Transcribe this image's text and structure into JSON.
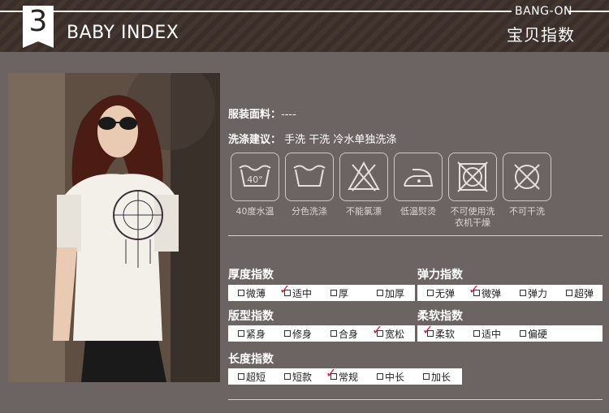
{
  "header": {
    "number": "3",
    "title_en": "BABY INDEX",
    "brand": "BANG-ON",
    "title_cn": "宝贝指数"
  },
  "material": {
    "label": "服装面料：",
    "value": "----"
  },
  "wash": {
    "label": "洗涤建议：",
    "value": "手洗 干洗 冷水单独洗涤"
  },
  "care_icons": [
    {
      "icon": "wash-40-icon",
      "caption": "40度水温"
    },
    {
      "icon": "wash-basin-icon",
      "caption": "分色洗涤"
    },
    {
      "icon": "no-bleach-icon",
      "caption": "不能氯漂"
    },
    {
      "icon": "low-iron-icon",
      "caption": "低温熨烫"
    },
    {
      "icon": "no-tumble-dry-icon",
      "caption": "不可使用洗衣机干燥"
    },
    {
      "icon": "no-dry-clean-icon",
      "caption": "不可干洗"
    }
  ],
  "indexes": {
    "thickness": {
      "title": "厚度指数",
      "options": [
        "微薄",
        "适中",
        "厚",
        "加厚"
      ],
      "selected": 1
    },
    "elasticity": {
      "title": "弹力指数",
      "options": [
        "无弹",
        "微弹",
        "弹力",
        "超弹"
      ],
      "selected": 1
    },
    "fit": {
      "title": "版型指数",
      "options": [
        "紧身",
        "修身",
        "合身",
        "宽松"
      ],
      "selected": 3
    },
    "softness": {
      "title": "柔软指数",
      "options": [
        "柔软",
        "适中",
        "偏硬"
      ],
      "selected": 0
    },
    "length": {
      "title": "长度指数",
      "options": [
        "超短",
        "短款",
        "常规",
        "中长",
        "加长"
      ],
      "selected": 2
    }
  },
  "colors": {
    "background": "#6b6462",
    "header": "#3a2e2b",
    "check": "#e0143c"
  }
}
